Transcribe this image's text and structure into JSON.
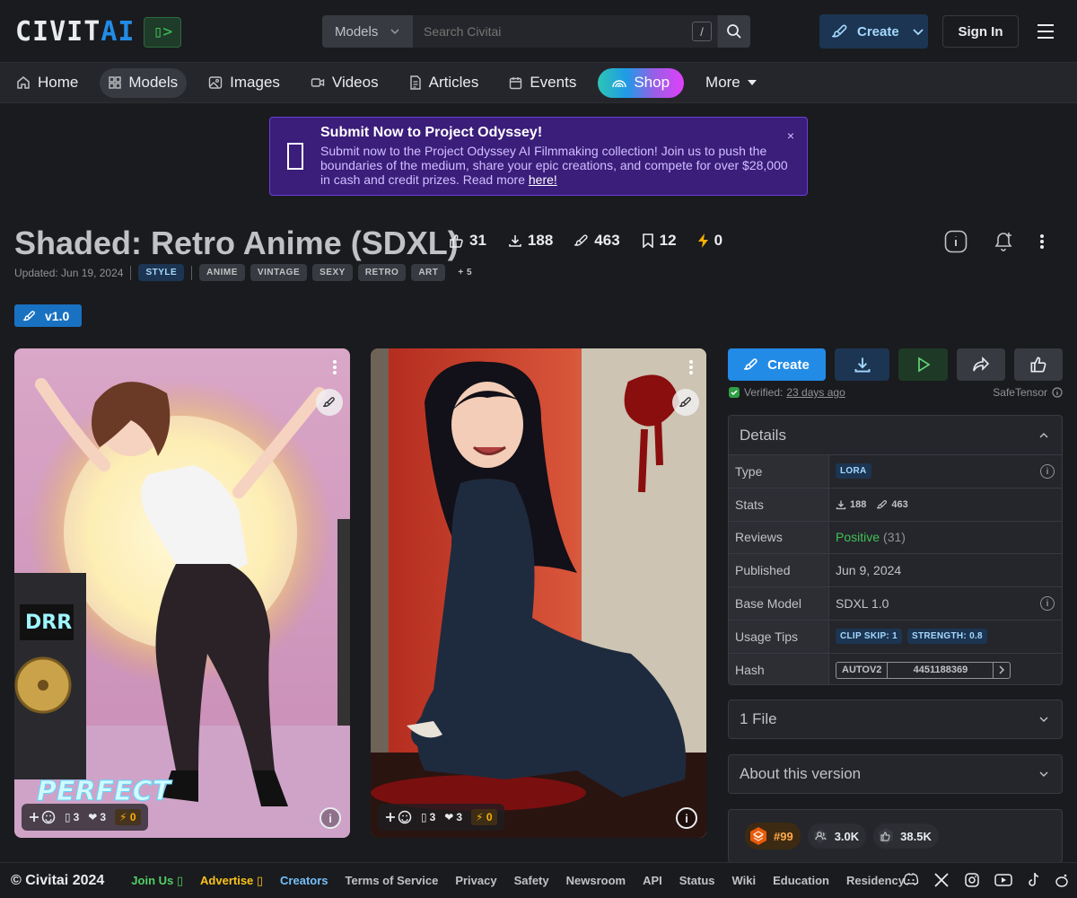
{
  "header": {
    "logo_main": "CIVIT",
    "logo_accent": "AI",
    "logo_box": "▯>",
    "search_scope": "Models",
    "search_placeholder": "Search Civitai",
    "search_shortcut": "/",
    "create_label": "Create",
    "signin_label": "Sign In"
  },
  "nav": {
    "items": [
      {
        "label": "Home",
        "icon": "home-icon"
      },
      {
        "label": "Models",
        "icon": "grid-icon"
      },
      {
        "label": "Images",
        "icon": "image-icon"
      },
      {
        "label": "Videos",
        "icon": "video-icon"
      },
      {
        "label": "Articles",
        "icon": "article-icon"
      },
      {
        "label": "Events",
        "icon": "calendar-icon"
      },
      {
        "label": "Shop",
        "icon": "rainbow-icon"
      },
      {
        "label": "More",
        "icon": "caret-down-icon"
      }
    ]
  },
  "banner": {
    "title": "Submit Now to Project Odyssey!",
    "text": "Submit now to the Project Odyssey AI Filmmaking collection! Join us to push the boundaries of the medium, share your epic creations, and compete for over $28,000 in cash and credit prizes. Read more ",
    "link": "here!",
    "close": "×"
  },
  "model": {
    "title": "Shaded: Retro Anime (SDXL)",
    "stats": {
      "likes": "31",
      "downloads": "188",
      "generations": "463",
      "bookmarks": "12",
      "buzz": "0"
    },
    "updated": "Updated: Jun 19, 2024",
    "category_tag": "STYLE",
    "tags": [
      "ANIME",
      "VINTAGE",
      "SEXY",
      "RETRO",
      "ART"
    ],
    "more_tags": "+ 5",
    "version": "v1.0"
  },
  "cards": [
    {
      "comments": "3",
      "hearts": "3",
      "buzz": "0",
      "caption": "PERFECT"
    },
    {
      "comments": "3",
      "hearts": "3",
      "buzz": "0"
    }
  ],
  "actions": {
    "create_label": "Create",
    "verified_prefix": "Verified:",
    "verified_when": "23 days ago",
    "format": "SafeTensor"
  },
  "details": {
    "heading": "Details",
    "type_label": "Type",
    "type_value": "LORA",
    "stats_label": "Stats",
    "stats_downloads": "188",
    "stats_generations": "463",
    "reviews_label": "Reviews",
    "reviews_value": "Positive",
    "reviews_count": "(31)",
    "published_label": "Published",
    "published_value": "Jun 9, 2024",
    "base_label": "Base Model",
    "base_value": "SDXL 1.0",
    "tips_label": "Usage Tips",
    "tip_clip": "CLIP SKIP: 1",
    "tip_strength": "STRENGTH: 0.8",
    "hash_label": "Hash",
    "hash_type": "AUTOV2",
    "hash_value": "4451188369"
  },
  "accordions": {
    "files": "1 File",
    "about": "About this version"
  },
  "creator": {
    "rank": "#99",
    "followers": "3.0K",
    "likes": "38.5K"
  },
  "footer": {
    "copyright": "© Civitai 2024",
    "links": [
      "Join Us ▯",
      "Advertise ▯",
      "Creators",
      "Terms of Service",
      "Privacy",
      "Safety",
      "Newsroom",
      "API",
      "Status",
      "Wiki",
      "Education",
      "Residency"
    ]
  },
  "colors": {
    "accent": "#228be6",
    "positive": "#40c057",
    "banner": "#3b1d7a"
  }
}
